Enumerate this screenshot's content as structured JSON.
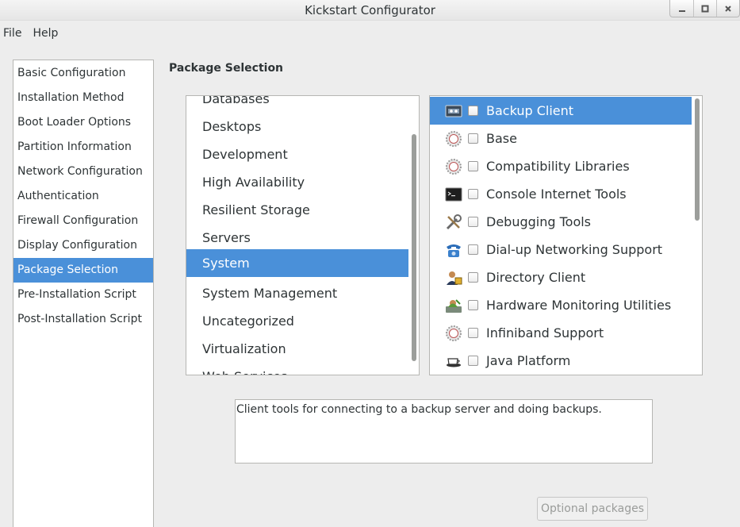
{
  "window": {
    "title": "Kickstart Configurator",
    "buttons": [
      "minimize-icon",
      "maximize-icon",
      "close-icon"
    ]
  },
  "menu": [
    "File",
    "Help"
  ],
  "sidebar": {
    "items": [
      "Basic Configuration",
      "Installation Method",
      "Boot Loader Options",
      "Partition Information",
      "Network Configuration",
      "Authentication",
      "Firewall Configuration",
      "Display Configuration",
      "Package Selection",
      "Pre-Installation Script",
      "Post-Installation Script"
    ],
    "selected": "Package Selection"
  },
  "section_title": "Package Selection",
  "groups": {
    "items": [
      "Databases",
      "Desktops",
      "Development",
      "High Availability",
      "Resilient Storage",
      "Servers",
      "System",
      "System Management",
      "Uncategorized",
      "Virtualization",
      "Web Services"
    ],
    "selected": "System"
  },
  "packages": {
    "items": [
      {
        "label": "Backup Client",
        "icon": "tape-drive-icon",
        "checked": false
      },
      {
        "label": "Base",
        "icon": "gear-icon",
        "checked": false
      },
      {
        "label": "Compatibility Libraries",
        "icon": "gear-icon",
        "checked": false
      },
      {
        "label": "Console Internet Tools",
        "icon": "terminal-icon",
        "checked": false
      },
      {
        "label": "Debugging Tools",
        "icon": "tools-icon",
        "checked": false
      },
      {
        "label": "Dial-up Networking Support",
        "icon": "phone-icon",
        "checked": false
      },
      {
        "label": "Directory Client",
        "icon": "directory-user-icon",
        "checked": false
      },
      {
        "label": "Hardware Monitoring Utilities",
        "icon": "hardware-monitor-icon",
        "checked": false
      },
      {
        "label": "Infiniband Support",
        "icon": "gear-icon",
        "checked": false
      },
      {
        "label": "Java Platform",
        "icon": "coffee-cup-icon",
        "checked": false
      }
    ],
    "selected": "Backup Client"
  },
  "description": "Client tools for connecting to a backup server and doing backups.",
  "optional_button": "Optional packages",
  "colors": {
    "selection": "#4a90d9",
    "background": "#ededed",
    "disabled_text": "#9a9c9a"
  }
}
